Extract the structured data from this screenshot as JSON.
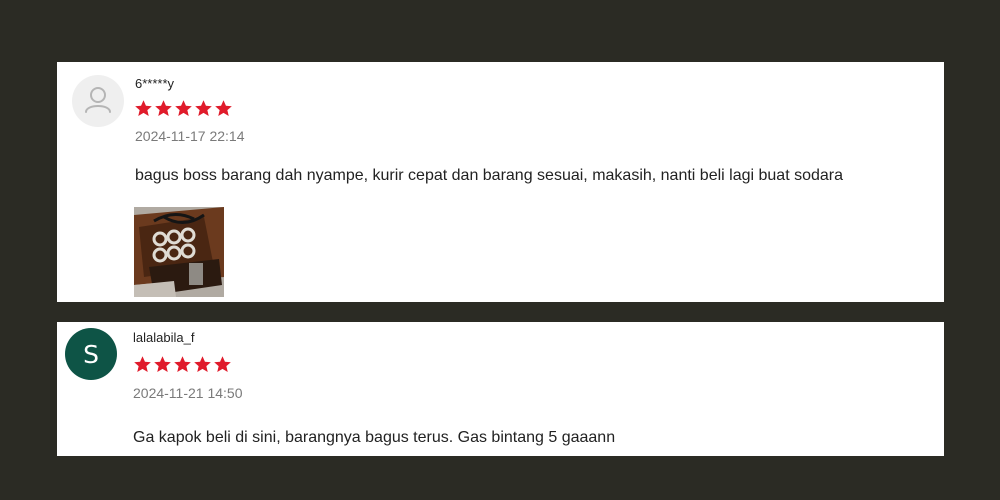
{
  "reviews": [
    {
      "username": "6*****y",
      "rating": 5,
      "timestamp": "2024-11-17 22:14",
      "text": "bagus boss barang dah nyampe, kurir cepat dan barang sesuai, makasih, nanti beli lagi buat sodara",
      "avatar_icon": "default-user-icon",
      "photo_count": 1
    },
    {
      "username": "lalalabila_f",
      "rating": 5,
      "timestamp": "2024-11-21 14:50",
      "text": "Ga kapok beli di sini, barangnya bagus terus. Gas bintang 5 gaaann",
      "avatar_letter": "S"
    }
  ],
  "colors": {
    "page_background": "#2b2b24",
    "card_background": "#ffffff",
    "star": "#e01b2b",
    "avatar_s": "#0e5446",
    "timestamp": "#7a7a7a"
  }
}
